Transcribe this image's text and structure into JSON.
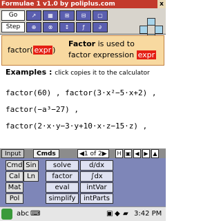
{
  "window": {
    "title": "Formulae 1 v1.0 by poliplus.com",
    "close_label": "x"
  },
  "toolbar": {
    "go_label": "Go",
    "step_label": "Step",
    "icons": [
      "vector-icon",
      "matrix-icon",
      "var-icon",
      "var-icon",
      "var-icon",
      "var-icon",
      "var-icon"
    ]
  },
  "definition": {
    "func_text": "factor(",
    "arg": "expr",
    "close": ")",
    "keyword": "Factor",
    "rest1": "is used to",
    "rest2": "factor expression",
    "arg2": "expr"
  },
  "examples": {
    "heading": "Examples :",
    "note": "click copies it to the calculator",
    "lines": [
      "factor(60) , factor(3·x²−5·x+2) ,",
      "factor(−a³−27) ,",
      "factor(2·x·y−3·y+10·x·z−15·z) ,"
    ]
  },
  "tabs": {
    "input": "Input",
    "cmds": "Cmds"
  },
  "pager": {
    "label": "1 of 2"
  },
  "commands": {
    "left": [
      "Cmd",
      "Sin",
      "Cal",
      "Ln",
      "Mat",
      "Pol"
    ],
    "mid": [
      "solve",
      "factor",
      "eval",
      "simplify"
    ],
    "right": [
      "d/dx",
      "∫dx",
      "intVar",
      "intParts"
    ]
  },
  "taskbar": {
    "start": "abc",
    "time": "3:42 PM"
  }
}
